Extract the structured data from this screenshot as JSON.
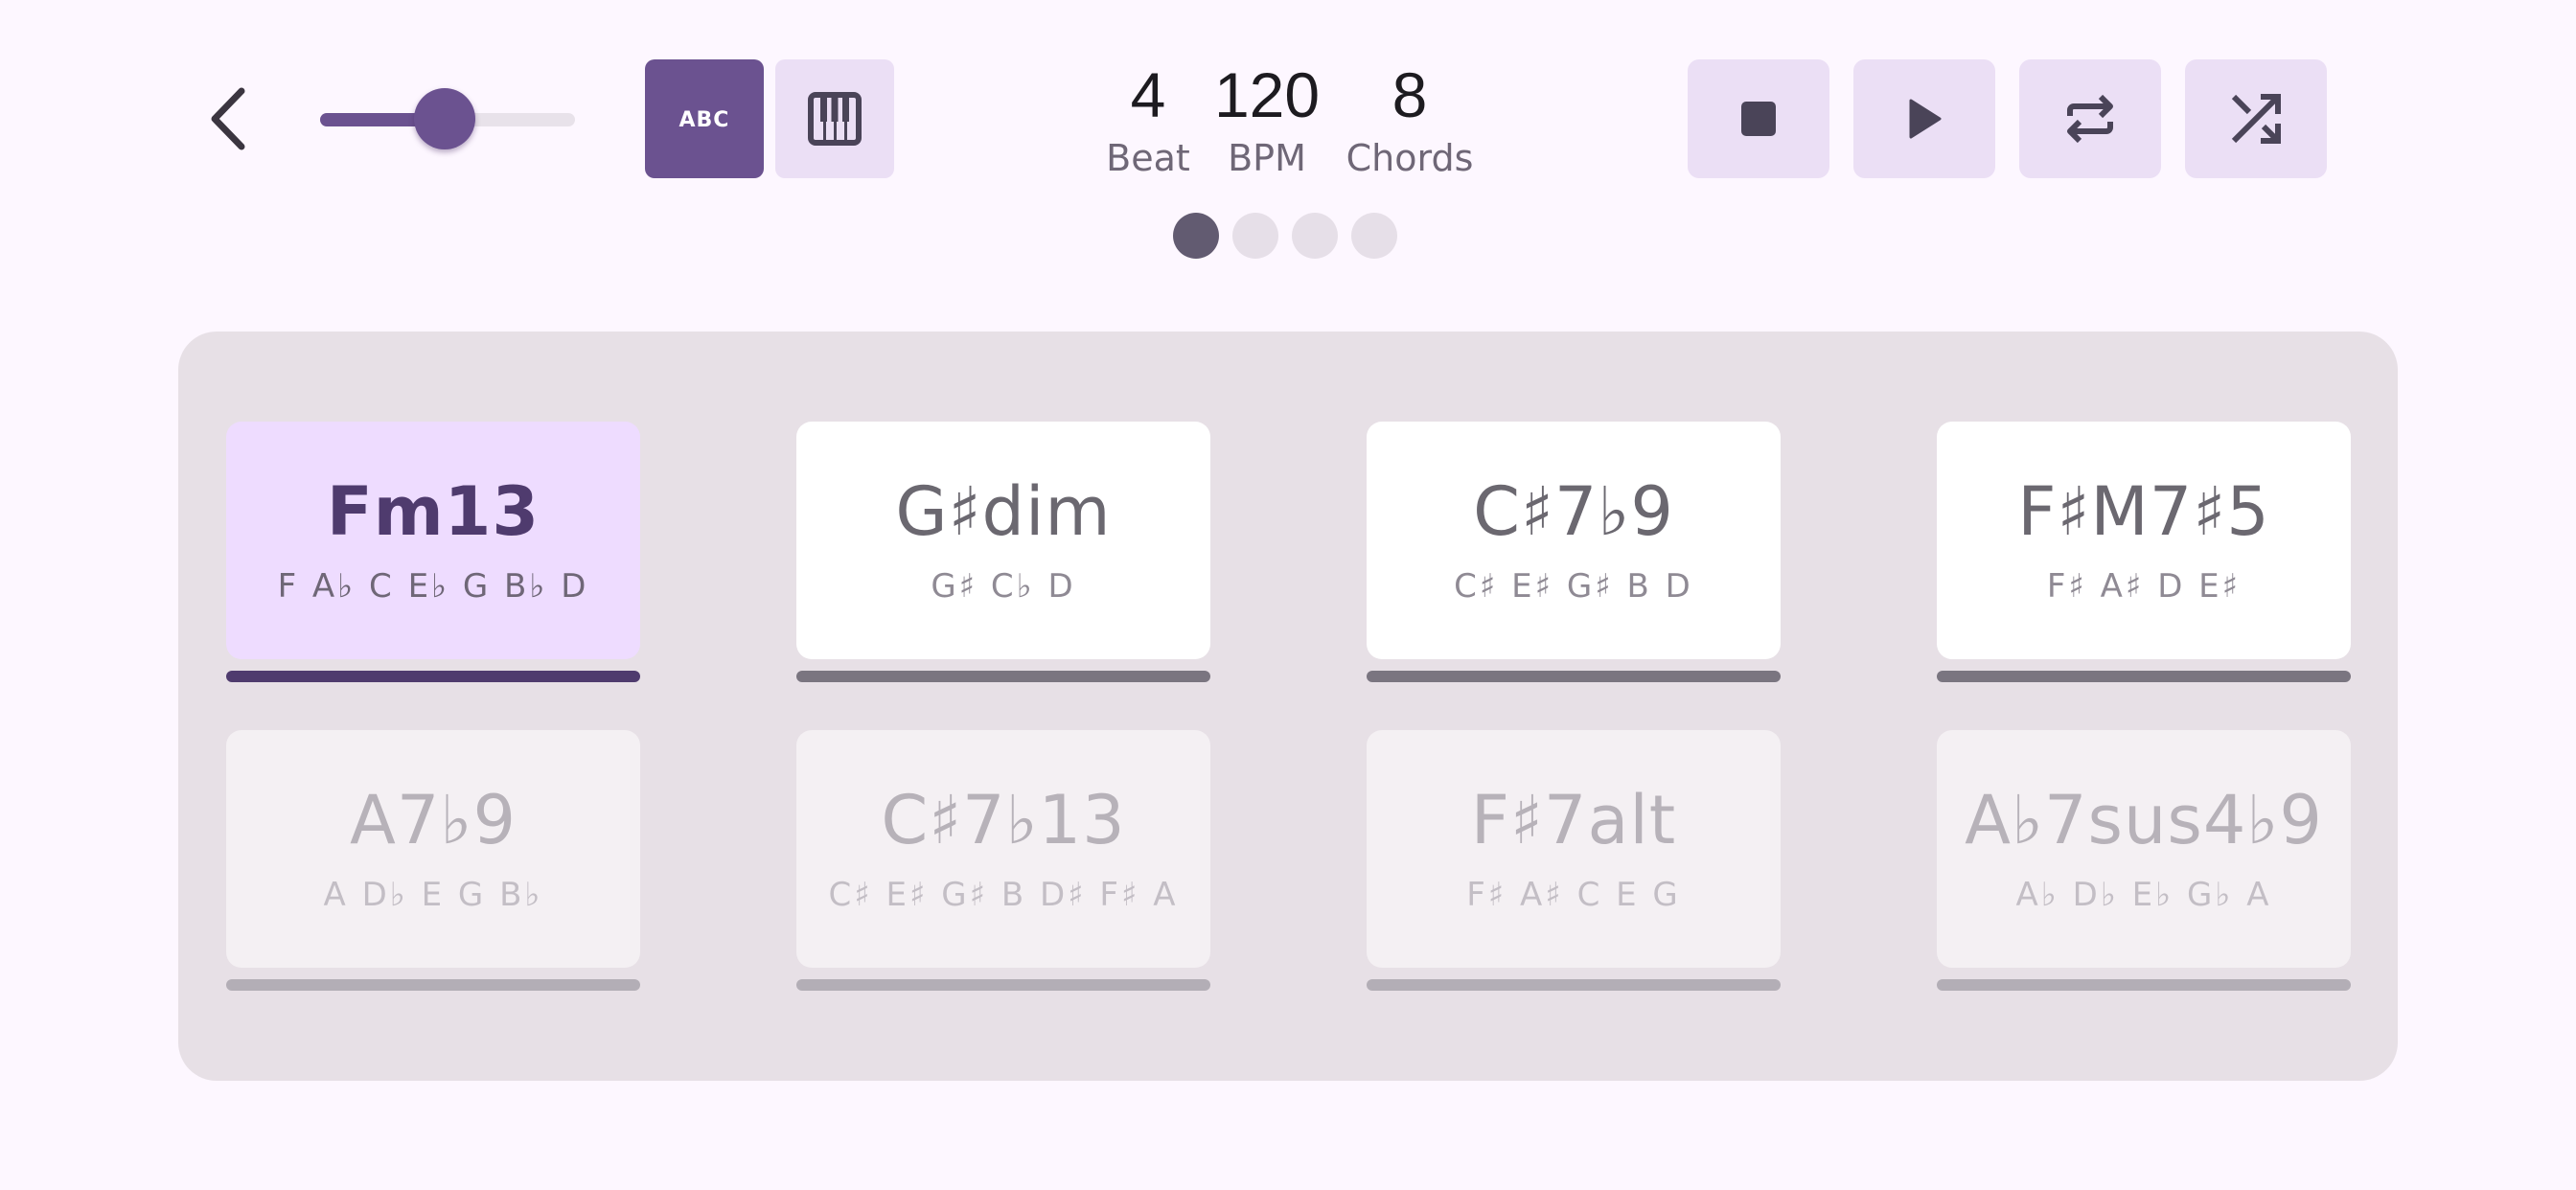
{
  "slider": {
    "value_fraction": 0.49
  },
  "mode_buttons": {
    "abc_label": "ABC"
  },
  "stats": {
    "beat": {
      "value": "4",
      "label": "Beat"
    },
    "bpm": {
      "value": "120",
      "label": "BPM"
    },
    "chords": {
      "value": "8",
      "label": "Chords"
    }
  },
  "pager": {
    "pages": 4,
    "active_index": 0
  },
  "chords": [
    {
      "name": "Fm13",
      "notes": "F A♭ C E♭ G B♭ D",
      "state": "active"
    },
    {
      "name": "G♯dim",
      "notes": "G♯ C♭ D",
      "state": "normal"
    },
    {
      "name": "C♯7♭9",
      "notes": "C♯ E♯ G♯ B D",
      "state": "normal"
    },
    {
      "name": "F♯M7♯5",
      "notes": "F♯ A♯ D E♯",
      "state": "normal"
    },
    {
      "name": "A7♭9",
      "notes": "A D♭ E G B♭",
      "state": "dim"
    },
    {
      "name": "C♯7♭13",
      "notes": "C♯ E♯ G♯ B D♯ F♯ A",
      "state": "dim"
    },
    {
      "name": "F♯7alt",
      "notes": "F♯ A♯ C E G",
      "state": "dim"
    },
    {
      "name": "A♭7sus4♭9",
      "notes": "A♭ D♭ E♭ G♭ A",
      "state": "dim"
    }
  ],
  "colors": {
    "background": "#fdf7ff",
    "accent": "#6b5290",
    "tonal_container": "#ebdff5",
    "active_card": "#eedcff",
    "panel": "#e7e0e6"
  },
  "icons": [
    "back-arrow-icon",
    "abc-icon",
    "piano-icon",
    "stop-icon",
    "play-icon",
    "repeat-icon",
    "shuffle-icon"
  ]
}
